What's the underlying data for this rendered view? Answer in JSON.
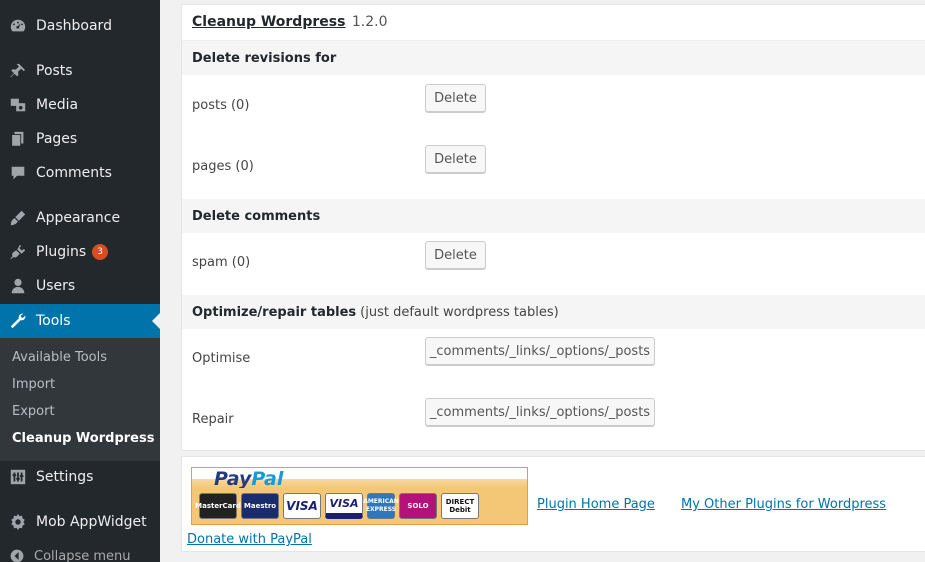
{
  "sidebar": {
    "items": [
      {
        "label": "Dashboard",
        "icon": "dashboard-icon"
      },
      {
        "label": "Posts",
        "icon": "pin-icon"
      },
      {
        "label": "Media",
        "icon": "media-icon"
      },
      {
        "label": "Pages",
        "icon": "pages-icon"
      },
      {
        "label": "Comments",
        "icon": "comment-icon"
      },
      {
        "label": "Appearance",
        "icon": "brush-icon"
      },
      {
        "label": "Plugins",
        "icon": "plug-icon",
        "badge": "3"
      },
      {
        "label": "Users",
        "icon": "user-icon"
      },
      {
        "label": "Tools",
        "icon": "wrench-icon"
      },
      {
        "label": "Settings",
        "icon": "settings-icon"
      },
      {
        "label": "Mob AppWidget",
        "icon": "gear-icon"
      }
    ],
    "submenu": [
      "Available Tools",
      "Import",
      "Export",
      "Cleanup Wordpress"
    ],
    "collapse": "Collapse menu"
  },
  "panel": {
    "title": "Cleanup Wordpress",
    "version": "1.2.0",
    "revisions_head": "Delete revisions for",
    "posts_label": "posts (0)",
    "pages_label": "pages (0)",
    "comments_head": "Delete comments",
    "spam_label": "spam (0)",
    "optimize_head": "Optimize/repair tables",
    "optimize_note": "(just default wordpress tables)",
    "optimise_label": "Optimise",
    "repair_label": "Repair",
    "delete_label": "Delete",
    "tables_label": "_comments/_links/_options/_posts"
  },
  "bottom": {
    "paypal_word_1": "Pay",
    "paypal_word_2": "Pal",
    "cards": [
      "MasterCard",
      "Maestro",
      "VISA",
      "VISA",
      "AMERICAN EXPRESS",
      "SOLO",
      "DIRECT Debit"
    ],
    "plugin_home": "Plugin Home Page",
    "other_plugins": "My Other Plugins for Wordpress",
    "donate": "Donate with PayPal"
  },
  "colors": {
    "sidebar_bg": "#23282d",
    "submenu_bg": "#32373c",
    "current_bg": "#0073aa",
    "badge_bg": "#d54e21",
    "link": "#0073aa"
  }
}
